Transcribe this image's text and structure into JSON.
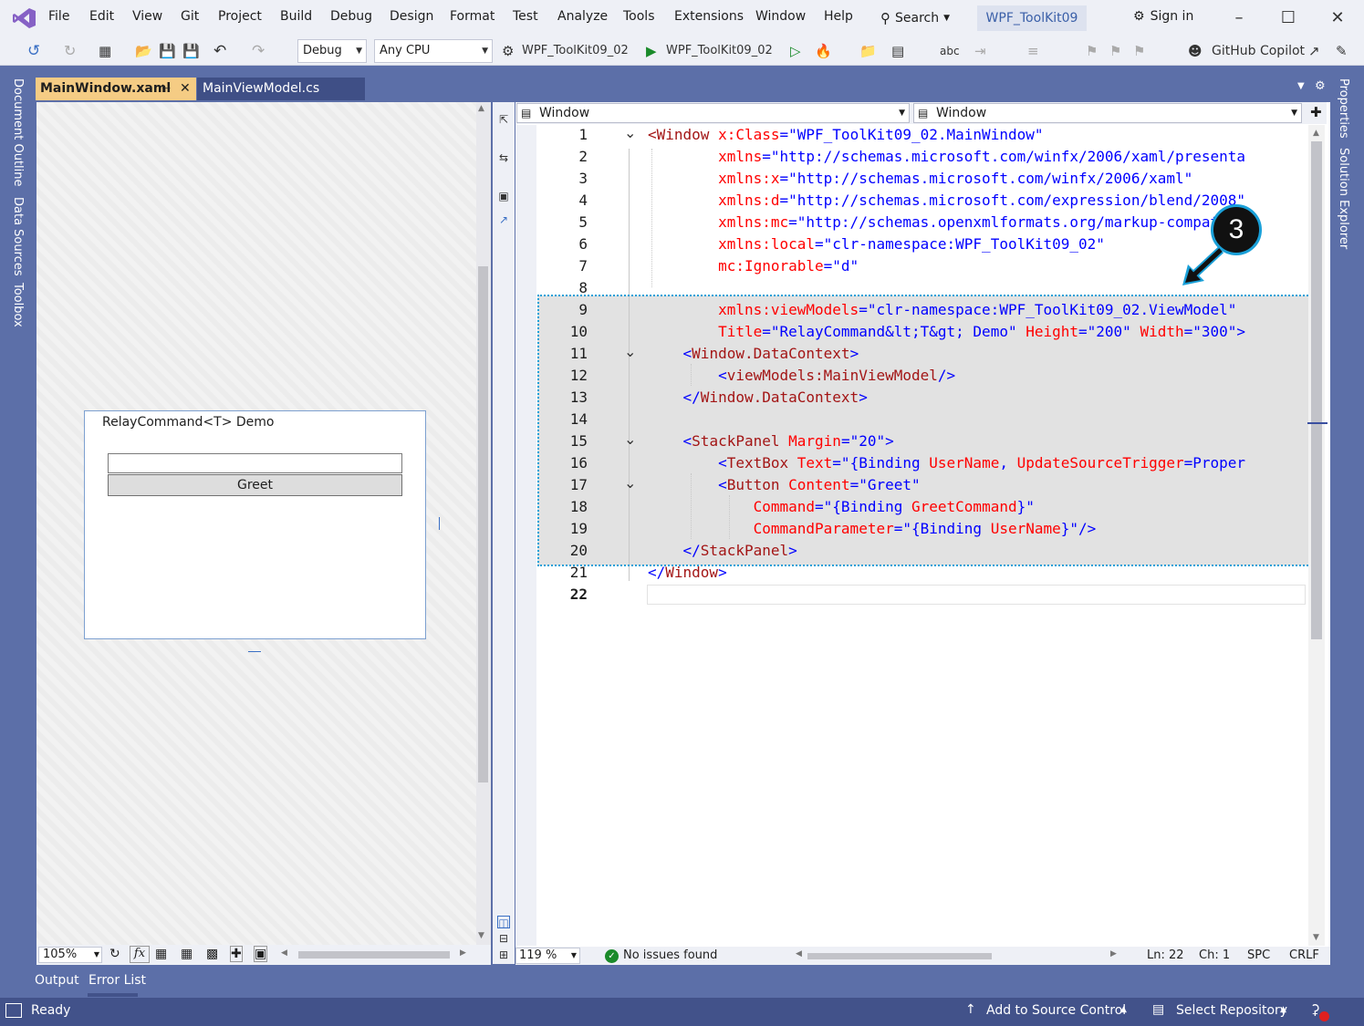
{
  "menu": [
    "File",
    "Edit",
    "View",
    "Git",
    "Project",
    "Build",
    "Debug",
    "Design",
    "Format",
    "Test",
    "Analyze",
    "Tools",
    "Extensions",
    "Window",
    "Help"
  ],
  "search_label": "Search",
  "solution_title": "WPF_ToolKit09",
  "sign_in": "Sign in",
  "toolbar": {
    "config": "Debug",
    "platform": "Any CPU",
    "startup_project": "WPF_ToolKit09_02",
    "run_target": "WPF_ToolKit09_02",
    "copilot": "GitHub Copilot"
  },
  "left_tabs": [
    "Document Outline",
    "Data Sources",
    "Toolbox"
  ],
  "right_tabs": [
    "Properties",
    "Solution Explorer"
  ],
  "doc_tabs": [
    "MainWindow.xaml",
    "MainViewModel.cs"
  ],
  "preview": {
    "title": "RelayCommand<T> Demo",
    "button": "Greet"
  },
  "designer_zoom": "105%",
  "nav": {
    "left": "Window",
    "right": "Window"
  },
  "line_numbers": [
    "1",
    "2",
    "3",
    "4",
    "5",
    "6",
    "7",
    "8",
    "9",
    "10",
    "11",
    "12",
    "13",
    "14",
    "15",
    "16",
    "17",
    "18",
    "19",
    "20",
    "21",
    "22"
  ],
  "callout": "3",
  "editor_status": {
    "zoom": "119 %",
    "issues": "No issues found",
    "ln": "Ln: 22",
    "ch": "Ch: 1",
    "spc": "SPC",
    "crlf": "CRLF"
  },
  "bottom_tabs": [
    "Output",
    "Error List"
  ],
  "status": {
    "ready": "Ready",
    "source_control": "Add to Source Control",
    "repository": "Select Repository"
  }
}
